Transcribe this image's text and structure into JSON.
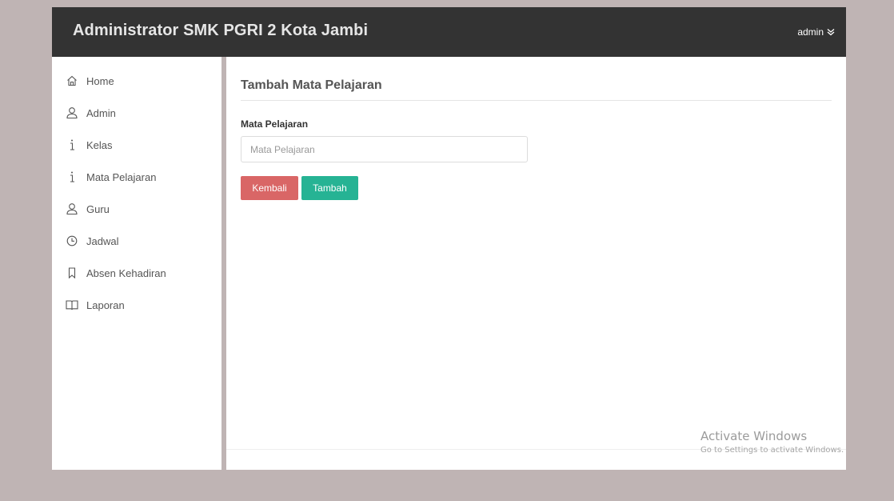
{
  "header": {
    "title": "Administrator SMK PGRI 2 Kota Jambi",
    "user_label": "admin",
    "user_icon": "chevron-double-down-icon"
  },
  "sidebar": {
    "items": [
      {
        "label": "Home",
        "icon": "home-icon"
      },
      {
        "label": "Admin",
        "icon": "user-icon"
      },
      {
        "label": "Kelas",
        "icon": "info-icon"
      },
      {
        "label": "Mata Pelajaran",
        "icon": "info-icon"
      },
      {
        "label": "Guru",
        "icon": "user-icon"
      },
      {
        "label": "Jadwal",
        "icon": "clock-icon"
      },
      {
        "label": "Absen Kehadiran",
        "icon": "bookmark-icon"
      },
      {
        "label": "Laporan",
        "icon": "book-icon"
      }
    ]
  },
  "main": {
    "title": "Tambah Mata Pelajaran",
    "form": {
      "field_label": "Mata Pelajaran",
      "field_value": "",
      "field_placeholder": "Mata Pelajaran",
      "back_label": "Kembali",
      "submit_label": "Tambah"
    }
  },
  "watermark": {
    "title": "Activate Windows",
    "subtitle": "Go to Settings to activate Windows."
  },
  "colors": {
    "topbar": "#333333",
    "background": "#bfb4b4",
    "danger_button": "#d96666",
    "success_button": "#26b394"
  }
}
